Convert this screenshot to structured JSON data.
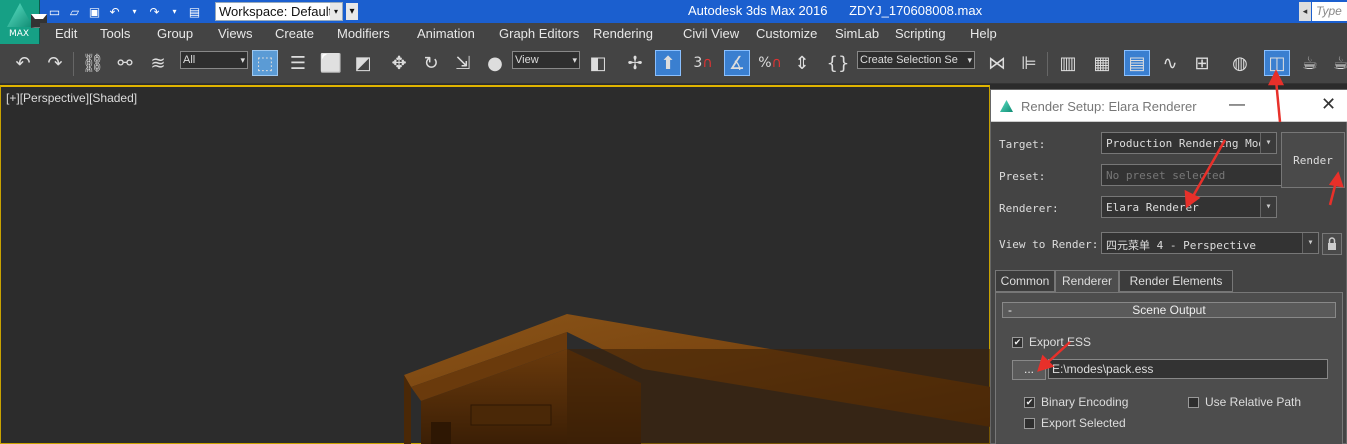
{
  "titlebar": {
    "workspace_label": "Workspace: Default",
    "app_name": "Autodesk 3ds Max 2016",
    "file_name": "ZDYJ_170608008.max",
    "search_placeholder": "Type a",
    "logo_text": "MAX"
  },
  "menu": [
    "Edit",
    "Tools",
    "Group",
    "Views",
    "Create",
    "Modifiers",
    "Animation",
    "Graph Editors",
    "Rendering",
    "Civil View",
    "Customize",
    "SimLab",
    "Scripting",
    "Help"
  ],
  "toolbar": {
    "selection_filter": "All",
    "reference_coord": "View",
    "named_selection": "Create Selection Se",
    "snap_3": "3",
    "percent_snap": "%"
  },
  "viewport": {
    "label_plus": "[+]",
    "label_view": "[Perspective]",
    "label_shading": "[Shaded]"
  },
  "render_setup": {
    "title": "Render Setup: Elara Renderer",
    "target_label": "Target:",
    "target_value": "Production Rendering Mode",
    "preset_label": "Preset:",
    "preset_value": "No preset selected",
    "renderer_label": "Renderer:",
    "renderer_value": "Elara Renderer",
    "view_label": "View to Render:",
    "view_value": "四元菜单 4 - Perspective",
    "render_button": "Render",
    "tabs": [
      "Common",
      "Renderer",
      "Render Elements"
    ],
    "rollout_title": "Scene Output",
    "rollout_toggle": "-",
    "export_ess_label": "Export ESS",
    "browse_button": "...",
    "export_path": "E:\\modes\\pack.ess",
    "binary_encoding_label": "Binary Encoding",
    "use_relative_path_label": "Use Relative Path",
    "export_selected_label": "Export Selected",
    "checks": {
      "export_ess": true,
      "binary_encoding": true,
      "use_relative_path": false,
      "export_selected": false
    }
  },
  "colors": {
    "titlebar": "#1b5fcf",
    "ui_dark": "#444444",
    "viewport_bg": "#2c2c2c",
    "viewport_border": "#e0b400",
    "annotation_red": "#e8302a"
  }
}
